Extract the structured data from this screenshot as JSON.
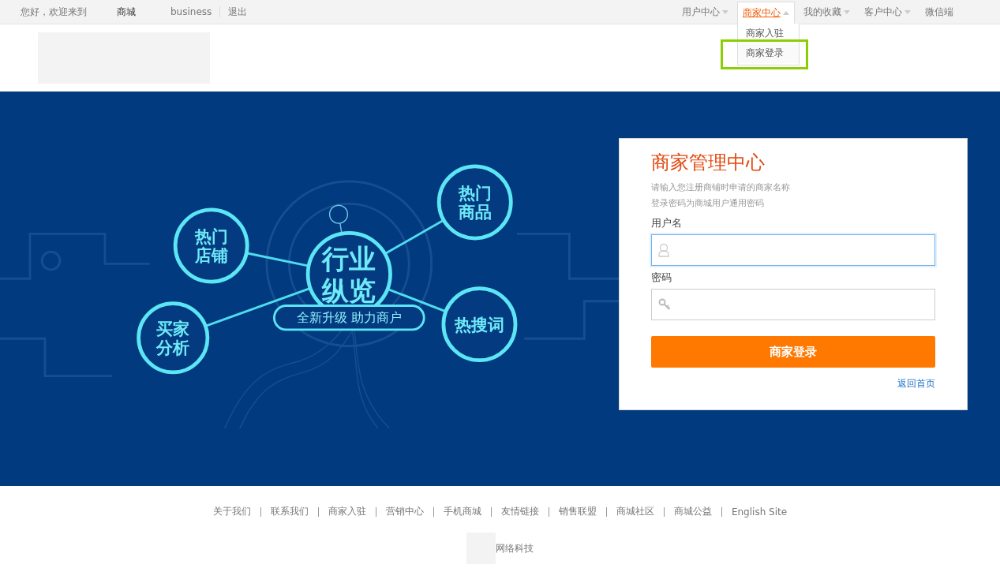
{
  "top_bar": {
    "greeting": "您好，欢迎来到",
    "mall": "商城",
    "user": "business",
    "logout": "退出",
    "menus": [
      {
        "label": "用户中心",
        "has_menu": true,
        "selected": false
      },
      {
        "label": "商家中心",
        "has_menu": true,
        "selected": true,
        "items": [
          {
            "label": "商家入驻",
            "highlighted": false
          },
          {
            "label": "商家登录",
            "highlighted": true
          }
        ]
      },
      {
        "label": "我的收藏",
        "has_menu": true,
        "selected": false
      },
      {
        "label": "客户中心",
        "has_menu": true,
        "selected": false
      },
      {
        "label": "微信端",
        "has_menu": false,
        "selected": false
      }
    ]
  },
  "banner": {
    "hub": {
      "lines": [
        "行业",
        "纵览"
      ]
    },
    "tagline": "全新升级 助力商户",
    "nodes": [
      {
        "lines": [
          "热门",
          "店铺"
        ]
      },
      {
        "lines": [
          "热门",
          "商品"
        ]
      },
      {
        "lines": [
          "买家",
          "分析"
        ]
      },
      {
        "lines": [
          "热搜词"
        ]
      }
    ]
  },
  "login": {
    "title": "商家管理中心",
    "hints": [
      "请输入您注册商铺时申请的商家名称",
      "登录密码为商城用户通用密码"
    ],
    "fields": [
      {
        "label": "用户名",
        "kind": "user",
        "focused": true
      },
      {
        "label": "密码",
        "kind": "password",
        "focused": false
      }
    ],
    "button": "商家登录",
    "back_link": "返回首页"
  },
  "footer": {
    "links": [
      "关于我们",
      "联系我们",
      "商家入驻",
      "营销中心",
      "手机商城",
      "友情链接",
      "销售联盟",
      "商城社区",
      "商城公益",
      "English Site"
    ],
    "company": "网络科技"
  }
}
